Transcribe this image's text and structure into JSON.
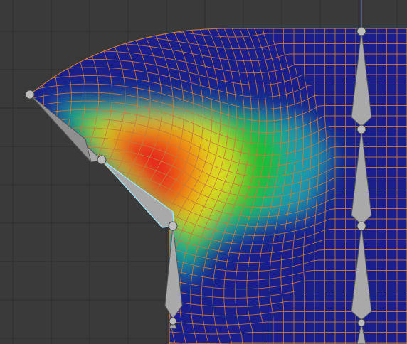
{
  "viewport": {
    "mode": "weight-paint",
    "background_color": "#3a3a3a",
    "grid_line_color": "#2e2e2e",
    "mesh_base_color": "#1a1f8c",
    "mesh_wire_color": "#c47a3c",
    "bone_color": "#a9a9a9",
    "bone_outline_color": "#5a5a5a",
    "selected_bone_outline_color": "#9fe0f0",
    "joint_color": "#bdbdbd"
  },
  "weight_gradient": [
    "#1a1f8c",
    "#1aa0b0",
    "#1fc02a",
    "#e8e020",
    "#f07a10",
    "#e51f1f"
  ],
  "bones": [
    {
      "name": "upper-arm-bone",
      "selected": false
    },
    {
      "name": "forearm-bone",
      "selected": true
    },
    {
      "name": "spine-bone",
      "selected": false
    },
    {
      "name": "right-chain-bone-1",
      "selected": false
    },
    {
      "name": "right-chain-bone-2",
      "selected": false
    },
    {
      "name": "right-chain-bone-3",
      "selected": false
    }
  ]
}
